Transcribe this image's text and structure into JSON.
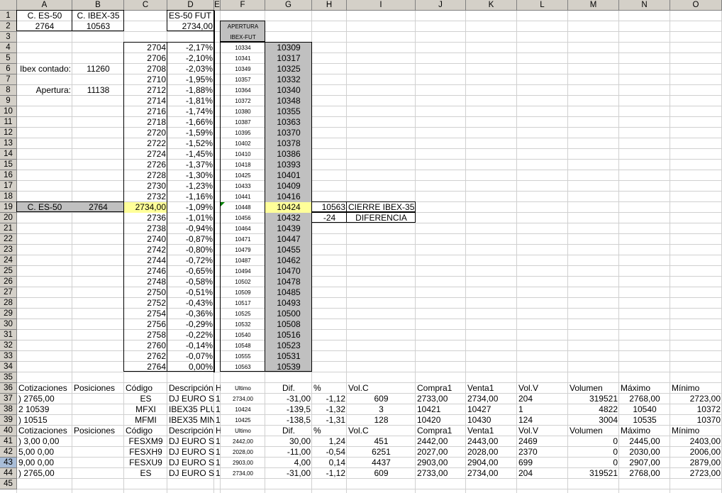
{
  "columns": [
    "A",
    "B",
    "C",
    "D",
    "E",
    "F",
    "G",
    "H",
    "I",
    "J",
    "K",
    "L",
    "M",
    "N",
    "O"
  ],
  "rows": [
    "1",
    "2",
    "3",
    "4",
    "5",
    "6",
    "7",
    "8",
    "9",
    "10",
    "11",
    "12",
    "13",
    "14",
    "15",
    "16",
    "17",
    "18",
    "19",
    "20",
    "21",
    "22",
    "23",
    "24",
    "25",
    "26",
    "27",
    "28",
    "29",
    "30",
    "31",
    "32",
    "33",
    "34",
    "35",
    "36",
    "37",
    "38",
    "39",
    "40",
    "41",
    "42",
    "43",
    "44",
    "45"
  ],
  "top": {
    "a1": "C. ES-50",
    "b1": "C. IBEX-35",
    "d1": "ES-50 FUT",
    "a2": "2764",
    "b2": "10563",
    "d2": "2734,00",
    "f_header1": "APERTURA",
    "f_header2": "IBEX-FUT",
    "ibex_contado_label": "Ibex contado:",
    "ibex_contado_value": "11260",
    "apertura_label": "Apertura:",
    "apertura_value": "11138",
    "a19": "C. ES-50",
    "b19": "2764",
    "h19": "10563",
    "i19": "CIERRE IBEX-35",
    "h20": "-24",
    "i20": "DIFERENCIA"
  },
  "ladder": {
    "c": [
      "2704",
      "2706",
      "2708",
      "2710",
      "2712",
      "2714",
      "2716",
      "2718",
      "2720",
      "2722",
      "2724",
      "2726",
      "2728",
      "2730",
      "2732",
      "2734,00",
      "2736",
      "2738",
      "2740",
      "2742",
      "2744",
      "2746",
      "2748",
      "2750",
      "2752",
      "2754",
      "2756",
      "2758",
      "2760",
      "2762",
      "2764"
    ],
    "d": [
      "-2,17%",
      "-2,10%",
      "-2,03%",
      "-1,95%",
      "-1,88%",
      "-1,81%",
      "-1,74%",
      "-1,66%",
      "-1,59%",
      "-1,52%",
      "-1,45%",
      "-1,37%",
      "-1,30%",
      "-1,23%",
      "-1,16%",
      "-1,09%",
      "-1,01%",
      "-0,94%",
      "-0,87%",
      "-0,80%",
      "-0,72%",
      "-0,65%",
      "-0,58%",
      "-0,51%",
      "-0,43%",
      "-0,36%",
      "-0,29%",
      "-0,22%",
      "-0,14%",
      "-0,07%",
      "0,00%"
    ],
    "f": [
      "10334",
      "10341",
      "10349",
      "10357",
      "10364",
      "10372",
      "10380",
      "10387",
      "10395",
      "10402",
      "10410",
      "10418",
      "10425",
      "10433",
      "10441",
      "10448",
      "10456",
      "10464",
      "10471",
      "10479",
      "10487",
      "10494",
      "10502",
      "10509",
      "10517",
      "10525",
      "10532",
      "10540",
      "10548",
      "10555",
      "10563"
    ],
    "g": [
      "10309",
      "10317",
      "10325",
      "10332",
      "10340",
      "10348",
      "10355",
      "10363",
      "10370",
      "10378",
      "10386",
      "10393",
      "10401",
      "10409",
      "10416",
      "10424",
      "10432",
      "10439",
      "10447",
      "10455",
      "10462",
      "10470",
      "10478",
      "10485",
      "10493",
      "10500",
      "10508",
      "10516",
      "10523",
      "10531",
      "10539"
    ]
  },
  "quotes": {
    "headers": [
      "Cotizaciones",
      "Posiciones",
      "Código",
      "Descripción",
      "H",
      "Ultimo",
      "Dif.",
      "%",
      "Vol.C",
      "Compra1",
      "Venta1",
      "Vol.V",
      "Volumen",
      "Máximo",
      "Mínimo"
    ],
    "rows36_39": [
      [
        ")  2765,00",
        "",
        "ES",
        "DJ EURO S",
        "1",
        "2734,00",
        "-31,00",
        "-1,12",
        "609",
        "2733,00",
        "2734,00",
        "204",
        "319521",
        "2768,00",
        "2723,00"
      ],
      [
        "2    10539",
        "",
        "MFXI",
        "IBEX35 PLU",
        "1",
        "10424",
        "-139,5",
        "-1,32",
        "3",
        "10421",
        "10427",
        "1",
        "4822",
        "10540",
        "10372"
      ],
      [
        ")   10515",
        "",
        "MFMI",
        "IBEX35 MIN",
        "1",
        "10425",
        "-138,5",
        "-1,31",
        "128",
        "10420",
        "10430",
        "124",
        "3004",
        "10535",
        "10370"
      ]
    ],
    "rows41_44": [
      [
        ")  3,00      0,00",
        "",
        "FESXM9",
        "DJ EURO S",
        "1",
        "2442,00",
        "30,00",
        "1,24",
        "451",
        "2442,00",
        "2443,00",
        "2469",
        "0",
        "2445,00",
        "2403,00"
      ],
      [
        "5,00      0,00",
        "",
        "FESXH9",
        "DJ EURO S",
        "1",
        "2028,00",
        "-11,00",
        "-0,54",
        "6251",
        "2027,00",
        "2028,00",
        "2370",
        "0",
        "2030,00",
        "2006,00"
      ],
      [
        "9,00      0,00",
        "",
        "FESXU9",
        "DJ EURO S",
        "1",
        "2903,00",
        "4,00",
        "0,14",
        "4437",
        "2903,00",
        "2904,00",
        "699",
        "0",
        "2907,00",
        "2879,00"
      ],
      [
        ")  2765,00",
        "",
        "ES",
        "DJ EURO S",
        "1",
        "2734,00",
        "-31,00",
        "-1,12",
        "609",
        "2733,00",
        "2734,00",
        "204",
        "319521",
        "2768,00",
        "2723,00"
      ]
    ]
  },
  "colors": {
    "gray_fill": "#c0c0c0",
    "yellow_fill": "#ffff99",
    "header_bg": "#d4d0c8"
  }
}
